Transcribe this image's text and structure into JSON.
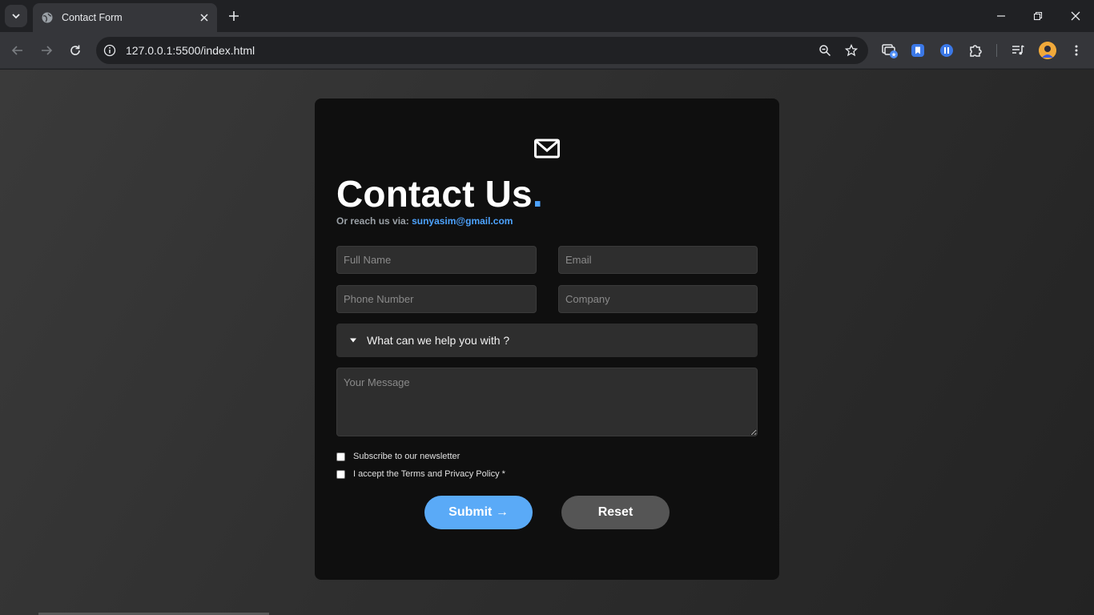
{
  "browser": {
    "tab_title": "Contact Form",
    "url": "127.0.0.1:5500/index.html"
  },
  "page": {
    "icon": "mail-icon",
    "heading": "Contact Us",
    "heading_dot": ".",
    "reach_prefix": "Or reach us via:",
    "reach_email": "sunyasim@gmail.com",
    "fields": {
      "full_name_placeholder": "Full Name",
      "email_placeholder": "Email",
      "phone_placeholder": "Phone Number",
      "company_placeholder": "Company",
      "message_placeholder": "Your Message"
    },
    "help_summary": "What can we help you with ?",
    "newsletter_label": "Subscribe to our newsletter",
    "terms_label": "I accept the Terms and Privacy Policy *",
    "submit_label": "Submit →",
    "reset_label": "Reset"
  },
  "colors": {
    "accent": "#4da3ff",
    "submit": "#5aaaf7",
    "reset": "#555555",
    "card": "#0f0f0f",
    "input": "#2e2e2e"
  }
}
